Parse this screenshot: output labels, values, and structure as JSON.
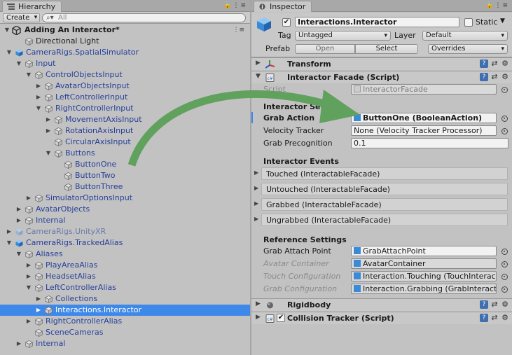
{
  "hierarchy": {
    "tab_label": "Hierarchy",
    "create_label": "Create",
    "search_placeholder": "All",
    "scene_name": "Adding An Interactor*",
    "rows": [
      {
        "label": "Directional Light",
        "indent": 2,
        "arrow": "",
        "style": "normal"
      },
      {
        "label": "CameraRigs.SpatialSimulator",
        "indent": 1,
        "arrow": "open",
        "style": "prefab"
      },
      {
        "label": "Input",
        "indent": 2,
        "arrow": "open",
        "style": "prefab"
      },
      {
        "label": "ControlObjectsInput",
        "indent": 3,
        "arrow": "open",
        "style": "prefab"
      },
      {
        "label": "AvatarObjectsInput",
        "indent": 4,
        "arrow": "closed",
        "style": "prefab"
      },
      {
        "label": "LeftControllerInput",
        "indent": 4,
        "arrow": "closed",
        "style": "prefab"
      },
      {
        "label": "RightControllerInput",
        "indent": 4,
        "arrow": "open",
        "style": "prefab"
      },
      {
        "label": "MovementAxisInput",
        "indent": 5,
        "arrow": "closed",
        "style": "prefab"
      },
      {
        "label": "RotationAxisInput",
        "indent": 5,
        "arrow": "closed",
        "style": "prefab"
      },
      {
        "label": "CircularAxisInput",
        "indent": 5,
        "arrow": "",
        "style": "prefab"
      },
      {
        "label": "Buttons",
        "indent": 5,
        "arrow": "open",
        "style": "prefab"
      },
      {
        "label": "ButtonOne",
        "indent": 6,
        "arrow": "",
        "style": "prefab"
      },
      {
        "label": "ButtonTwo",
        "indent": 6,
        "arrow": "",
        "style": "prefab"
      },
      {
        "label": "ButtonThree",
        "indent": 6,
        "arrow": "",
        "style": "prefab"
      },
      {
        "label": "SimulatorOptionsInput",
        "indent": 3,
        "arrow": "closed",
        "style": "prefab"
      },
      {
        "label": "AvatarObjects",
        "indent": 2,
        "arrow": "closed",
        "style": "prefab"
      },
      {
        "label": "Internal",
        "indent": 2,
        "arrow": "closed",
        "style": "prefab"
      },
      {
        "label": "CameraRigs.UnityXR",
        "indent": 1,
        "arrow": "closed",
        "style": "disabled"
      },
      {
        "label": "CameraRigs.TrackedAlias",
        "indent": 1,
        "arrow": "open",
        "style": "prefab"
      },
      {
        "label": "Aliases",
        "indent": 2,
        "arrow": "open",
        "style": "prefab"
      },
      {
        "label": "PlayAreaAlias",
        "indent": 3,
        "arrow": "closed",
        "style": "prefab"
      },
      {
        "label": "HeadsetAlias",
        "indent": 3,
        "arrow": "closed",
        "style": "prefab"
      },
      {
        "label": "LeftControllerAlias",
        "indent": 3,
        "arrow": "open",
        "style": "prefab"
      },
      {
        "label": "Collections",
        "indent": 4,
        "arrow": "closed",
        "style": "prefab"
      },
      {
        "label": "Interactions.Interactor",
        "indent": 4,
        "arrow": "closed",
        "style": "selected"
      },
      {
        "label": "RightControllerAlias",
        "indent": 3,
        "arrow": "closed",
        "style": "prefab"
      },
      {
        "label": "SceneCameras",
        "indent": 3,
        "arrow": "",
        "style": "prefab"
      },
      {
        "label": "Internal",
        "indent": 2,
        "arrow": "closed",
        "style": "prefab"
      }
    ]
  },
  "inspector": {
    "tab_label": "Inspector",
    "object_name": "Interactions.Interactor",
    "active": true,
    "static_label": "Static",
    "tag_label": "Tag",
    "tag_value": "Untagged",
    "layer_label": "Layer",
    "layer_value": "Default",
    "prefab_label": "Prefab",
    "prefab_open": "Open",
    "prefab_select": "Select",
    "prefab_overrides": "Overrides",
    "components": {
      "transform": "Transform",
      "facade": "Interactor Facade (Script)",
      "rigidbody": "Rigidbody",
      "collision": "Collision Tracker (Script)"
    },
    "script_label": "Script",
    "script_value": "InteractorFacade",
    "settings_header": "Interactor Settings",
    "grab_action_label": "Grab Action",
    "grab_action_value": "ButtonOne (BooleanAction)",
    "velocity_label": "Velocity Tracker",
    "velocity_value": "None (Velocity Tracker Processor)",
    "precognition_label": "Grab Precognition",
    "precognition_value": "0.1",
    "events_header": "Interactor Events",
    "events": [
      "Touched (InteractableFacade)",
      "Untouched (InteractableFacade)",
      "Grabbed (InteractableFacade)",
      "Ungrabbed (InteractableFacade)"
    ],
    "reference_header": "Reference Settings",
    "attach_label": "Grab Attach Point",
    "attach_value": "GrabAttachPoint",
    "avatar_label": "Avatar Container",
    "avatar_value": "AvatarContainer",
    "touch_label": "Touch Configuration",
    "touch_value": "Interaction.Touching (TouchInteractorConfigurator)",
    "grab_label": "Grab Configuration",
    "grab_value": "Interaction.Grabbing (GrabInteractorConfigurator)"
  },
  "colors": {
    "selection": "#3d88e8",
    "arrow": "#5fa15d"
  }
}
